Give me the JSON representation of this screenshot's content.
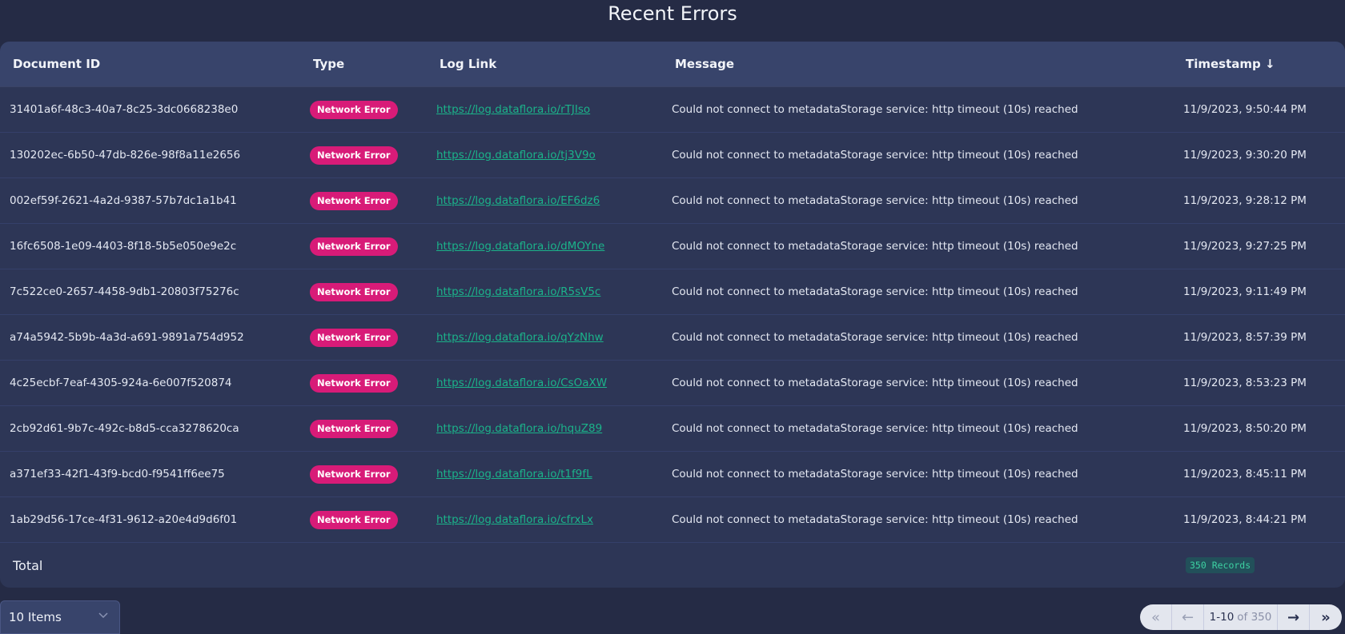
{
  "page": {
    "title": "Recent Errors"
  },
  "table": {
    "columns": {
      "document_id": "Document ID",
      "type": "Type",
      "log_link": "Log Link",
      "message": "Message",
      "timestamp": "Timestamp ↓"
    },
    "sort": {
      "column": "Timestamp",
      "direction": "descending"
    },
    "rows": [
      {
        "document_id": "31401a6f-48c3-40a7-8c25-3dc0668238e0",
        "type": "Network Error",
        "log_link": "https://log.dataflora.io/rTJIso",
        "message": "Could not connect to metadataStorage service: http timeout (10s) reached",
        "timestamp": "11/9/2023, 9:50:44 PM"
      },
      {
        "document_id": "130202ec-6b50-47db-826e-98f8a11e2656",
        "type": "Network Error",
        "log_link": "https://log.dataflora.io/tj3V9o",
        "message": "Could not connect to metadataStorage service: http timeout (10s) reached",
        "timestamp": "11/9/2023, 9:30:20 PM"
      },
      {
        "document_id": "002ef59f-2621-4a2d-9387-57b7dc1a1b41",
        "type": "Network Error",
        "log_link": "https://log.dataflora.io/EF6dz6",
        "message": "Could not connect to metadataStorage service: http timeout (10s) reached",
        "timestamp": "11/9/2023, 9:28:12 PM"
      },
      {
        "document_id": "16fc6508-1e09-4403-8f18-5b5e050e9e2c",
        "type": "Network Error",
        "log_link": "https://log.dataflora.io/dMOYne",
        "message": "Could not connect to metadataStorage service: http timeout (10s) reached",
        "timestamp": "11/9/2023, 9:27:25 PM"
      },
      {
        "document_id": "7c522ce0-2657-4458-9db1-20803f75276c",
        "type": "Network Error",
        "log_link": "https://log.dataflora.io/R5sV5c",
        "message": "Could not connect to metadataStorage service: http timeout (10s) reached",
        "timestamp": "11/9/2023, 9:11:49 PM"
      },
      {
        "document_id": "a74a5942-5b9b-4a3d-a691-9891a754d952",
        "type": "Network Error",
        "log_link": "https://log.dataflora.io/qYzNhw",
        "message": "Could not connect to metadataStorage service: http timeout (10s) reached",
        "timestamp": "11/9/2023, 8:57:39 PM"
      },
      {
        "document_id": "4c25ecbf-7eaf-4305-924a-6e007f520874",
        "type": "Network Error",
        "log_link": "https://log.dataflora.io/CsOaXW",
        "message": "Could not connect to metadataStorage service: http timeout (10s) reached",
        "timestamp": "11/9/2023, 8:53:23 PM"
      },
      {
        "document_id": "2cb92d61-9b7c-492c-b8d5-cca3278620ca",
        "type": "Network Error",
        "log_link": "https://log.dataflora.io/hquZ89",
        "message": "Could not connect to metadataStorage service: http timeout (10s) reached",
        "timestamp": "11/9/2023, 8:50:20 PM"
      },
      {
        "document_id": "a371ef33-42f1-43f9-bcd0-f9541ff6ee75",
        "type": "Network Error",
        "log_link": "https://log.dataflora.io/t1f9fL",
        "message": "Could not connect to metadataStorage service: http timeout (10s) reached",
        "timestamp": "11/9/2023, 8:45:11 PM"
      },
      {
        "document_id": "1ab29d56-17ce-4f31-9612-a20e4d9d6f01",
        "type": "Network Error",
        "log_link": "https://log.dataflora.io/cfrxLx",
        "message": "Could not connect to metadataStorage service: http timeout (10s) reached",
        "timestamp": "11/9/2023, 8:44:21 PM"
      }
    ],
    "footer": {
      "label": "Total",
      "records": "350 Records"
    }
  },
  "page_size": {
    "selected": "10 Items",
    "icon": "chevron-down-icon"
  },
  "pagination": {
    "range": "1-10",
    "of_label": "of 350",
    "first_icon": "«",
    "prev_icon": "←",
    "next_icon": "→",
    "last_icon": "»",
    "first_enabled": false,
    "prev_enabled": false,
    "next_enabled": true,
    "last_enabled": true
  },
  "colors": {
    "background": "#252b45",
    "card": "#2d3656",
    "header": "#38446b",
    "badge_error": "#d81b78",
    "link": "#1bb38a",
    "records_badge_bg": "#22505a",
    "records_badge_text": "#3dd1a2"
  }
}
